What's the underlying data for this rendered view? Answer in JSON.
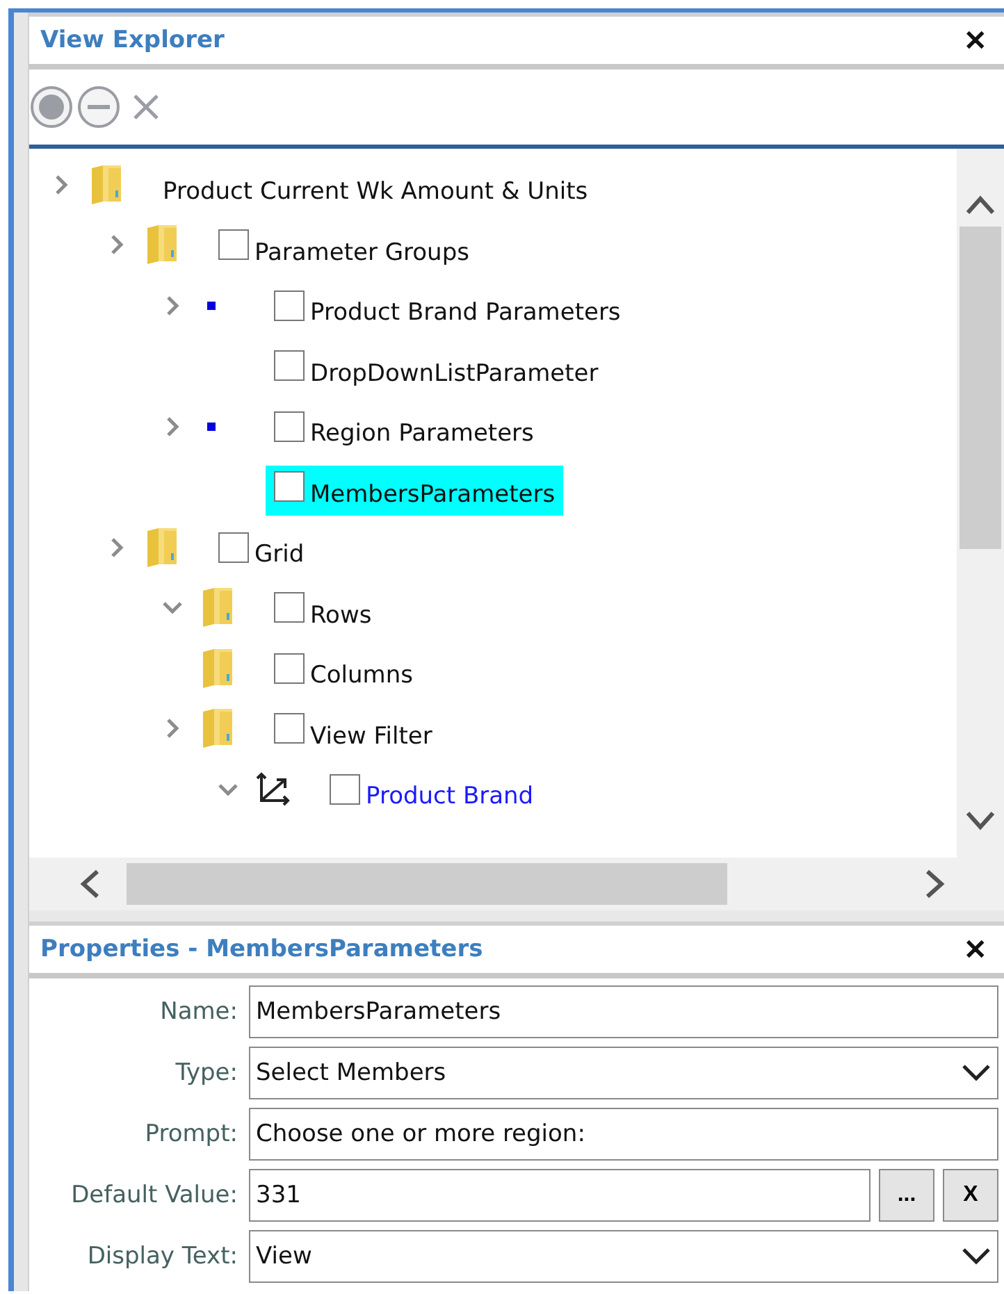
{
  "explorer": {
    "title": "View Explorer",
    "close": "✕"
  },
  "toolbar": [
    {
      "kind": "record",
      "disabled": true
    },
    {
      "kind": "minus",
      "disabled": true
    },
    {
      "kind": "cross",
      "disabled": true
    }
  ],
  "tree": [
    {
      "label": "Product Current Wk Amount & Units",
      "kind": "folder",
      "expanded": false,
      "selected": false,
      "link": false,
      "children": [
        {
          "label": "Parameter Groups",
          "kind": "folder",
          "expanded": false,
          "checked": false,
          "selected": false,
          "link": false,
          "children": [
            {
              "label": "Product Brand Parameters",
              "kind": "dot",
              "expanded": false,
              "checked": false,
              "selected": false,
              "link": false
            },
            {
              "label": "DropDownListParameter",
              "kind": "none",
              "checked": false,
              "selected": false,
              "link": false
            },
            {
              "label": "Region Parameters",
              "kind": "dot",
              "expanded": false,
              "checked": false,
              "selected": false,
              "link": false
            },
            {
              "label": "MembersParameters",
              "kind": "none",
              "checked": false,
              "selected": true,
              "link": false
            }
          ]
        },
        {
          "label": "Grid",
          "kind": "folder",
          "expanded": false,
          "checked": false,
          "selected": false,
          "link": false,
          "children": [
            {
              "label": "Rows",
              "kind": "folder",
              "expanded": true,
              "checked": false,
              "selected": false,
              "link": false
            },
            {
              "label": "Columns",
              "kind": "folder",
              "checked": false,
              "selected": false,
              "link": false
            },
            {
              "label": "View Filter",
              "kind": "folder",
              "expanded": false,
              "checked": false,
              "selected": false,
              "link": false,
              "children": [
                {
                  "label": "Product Brand",
                  "kind": "axis",
                  "expanded": true,
                  "checked": false,
                  "selected": false,
                  "link": true
                }
              ]
            }
          ]
        }
      ]
    }
  ],
  "properties": {
    "title": "Properties - MembersParameters",
    "close": "✕",
    "fields": [
      {
        "label": "Name:",
        "value": "MembersParameters",
        "kind": "text"
      },
      {
        "label": "Type:",
        "value": "Select Members",
        "kind": "dropdown"
      },
      {
        "label": "Prompt:",
        "value": "Choose one or more region:",
        "kind": "text"
      },
      {
        "label": "Default Value:",
        "value": "331",
        "kind": "picker",
        "buttons": [
          "...",
          "X"
        ]
      },
      {
        "label": "Display Text:",
        "value": "View",
        "kind": "dropdown"
      }
    ]
  }
}
